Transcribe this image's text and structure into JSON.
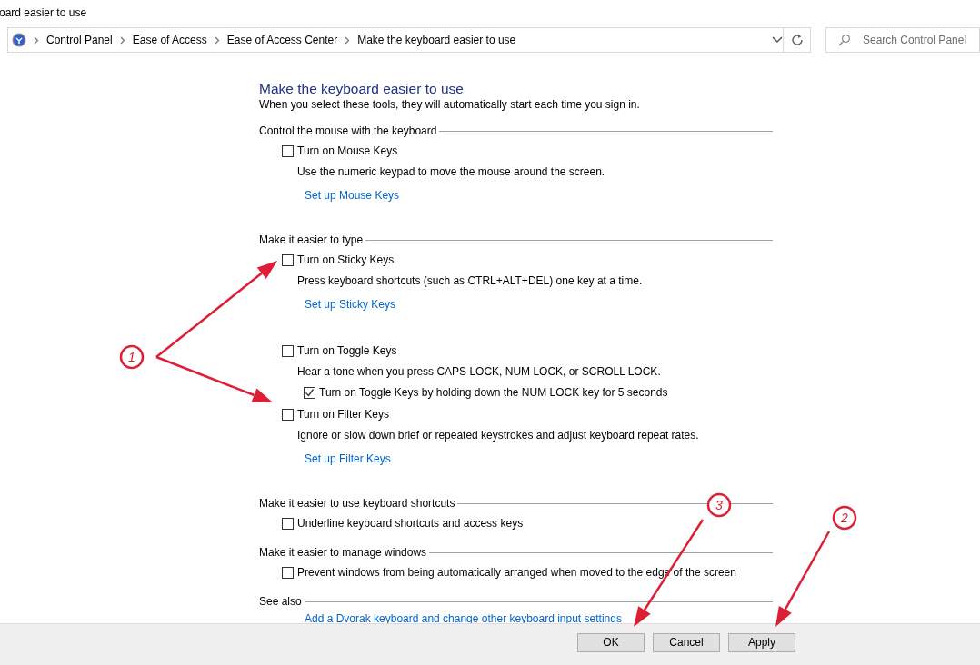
{
  "window": {
    "title": "oard easier to use"
  },
  "address_bar": {
    "breadcrumbs": [
      "Control Panel",
      "Ease of Access",
      "Ease of Access Center",
      "Make the keyboard easier to use"
    ]
  },
  "search": {
    "placeholder": "Search Control Panel"
  },
  "page": {
    "heading": "Make the keyboard easier to use",
    "intro": "When you select these tools, they will automatically start each time you sign in.",
    "sections": [
      {
        "title": "Control the mouse with the keyboard",
        "items": [
          {
            "kind": "checkbox",
            "label": "Turn on Mouse Keys",
            "checked": false
          },
          {
            "kind": "text",
            "label": "Use the numeric keypad to move the mouse around the screen."
          },
          {
            "kind": "link",
            "label": "Set up Mouse Keys"
          }
        ]
      },
      {
        "title": "Make it easier to type",
        "items": [
          {
            "kind": "checkbox",
            "label": "Turn on Sticky Keys",
            "checked": false
          },
          {
            "kind": "text",
            "label": "Press keyboard shortcuts (such as CTRL+ALT+DEL) one key at a time."
          },
          {
            "kind": "link",
            "label": "Set up Sticky Keys"
          },
          {
            "kind": "checkbox",
            "label": "Turn on Toggle Keys",
            "checked": false
          },
          {
            "kind": "text",
            "label": "Hear a tone when you press CAPS LOCK, NUM LOCK, or SCROLL LOCK."
          },
          {
            "kind": "subcheckbox",
            "label": "Turn on Toggle Keys by holding down the NUM LOCK key for 5 seconds",
            "checked": true
          },
          {
            "kind": "checkbox",
            "label": "Turn on Filter Keys",
            "checked": false
          },
          {
            "kind": "text",
            "label": "Ignore or slow down brief or repeated keystrokes and adjust keyboard repeat rates."
          },
          {
            "kind": "link",
            "label": "Set up Filter Keys"
          }
        ]
      },
      {
        "title": "Make it easier to use keyboard shortcuts",
        "items": [
          {
            "kind": "checkbox",
            "label": "Underline keyboard shortcuts and access keys",
            "checked": false
          }
        ]
      },
      {
        "title": "Make it easier to manage windows",
        "items": [
          {
            "kind": "checkbox",
            "label": "Prevent windows from being automatically arranged when moved to the edge of the screen",
            "checked": false
          }
        ]
      },
      {
        "title": "See also",
        "items": [
          {
            "kind": "link",
            "label": "Add a Dvorak keyboard and change other keyboard input settings"
          }
        ]
      }
    ]
  },
  "buttons": [
    "OK",
    "Cancel",
    "Apply"
  ],
  "annotations": [
    {
      "number": "1"
    },
    {
      "number": "3"
    },
    {
      "number": "2"
    }
  ]
}
